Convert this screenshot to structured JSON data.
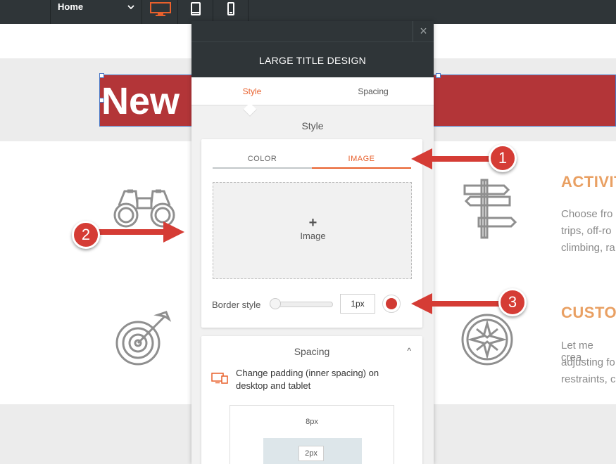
{
  "topbar": {
    "page_select": "Home",
    "devices": [
      {
        "name": "desktop",
        "active": true
      },
      {
        "name": "tablet",
        "active": false
      },
      {
        "name": "mobile",
        "active": false
      }
    ]
  },
  "page": {
    "title_text": "New",
    "features": [
      {
        "title": "ACTIVIT",
        "lines": [
          "Choose fro",
          "trips, off-ro",
          "climbing, ra"
        ]
      },
      {
        "title": "CUSTO",
        "lines": [
          "Let me crea",
          "adjusting fo",
          "restraints, c"
        ]
      }
    ]
  },
  "panel": {
    "close_glyph": "×",
    "header": "LARGE TITLE DESIGN",
    "tabs": [
      "Style",
      "Spacing"
    ],
    "active_tab": "Style",
    "style_section_title": "Style",
    "subtabs": [
      "COLOR",
      "IMAGE"
    ],
    "active_subtab": "IMAGE",
    "image_dropzone": {
      "plus": "+",
      "label": "Image"
    },
    "border": {
      "label": "Border style",
      "value": "1px",
      "color": "#d13a33",
      "slider_fraction": 0.0
    },
    "spacing": {
      "title": "Spacing",
      "caret": "^",
      "padding_text": "Change padding (inner spacing) on desktop and tablet",
      "outer_value": "8px",
      "inner_value": "2px"
    }
  },
  "annotations": [
    "1",
    "2",
    "3"
  ],
  "colors": {
    "accent": "#e8602c",
    "title_bg": "#b33538",
    "topbar": "#2f3538",
    "feature_title": "#e9a063",
    "annotation": "#d53c35"
  }
}
